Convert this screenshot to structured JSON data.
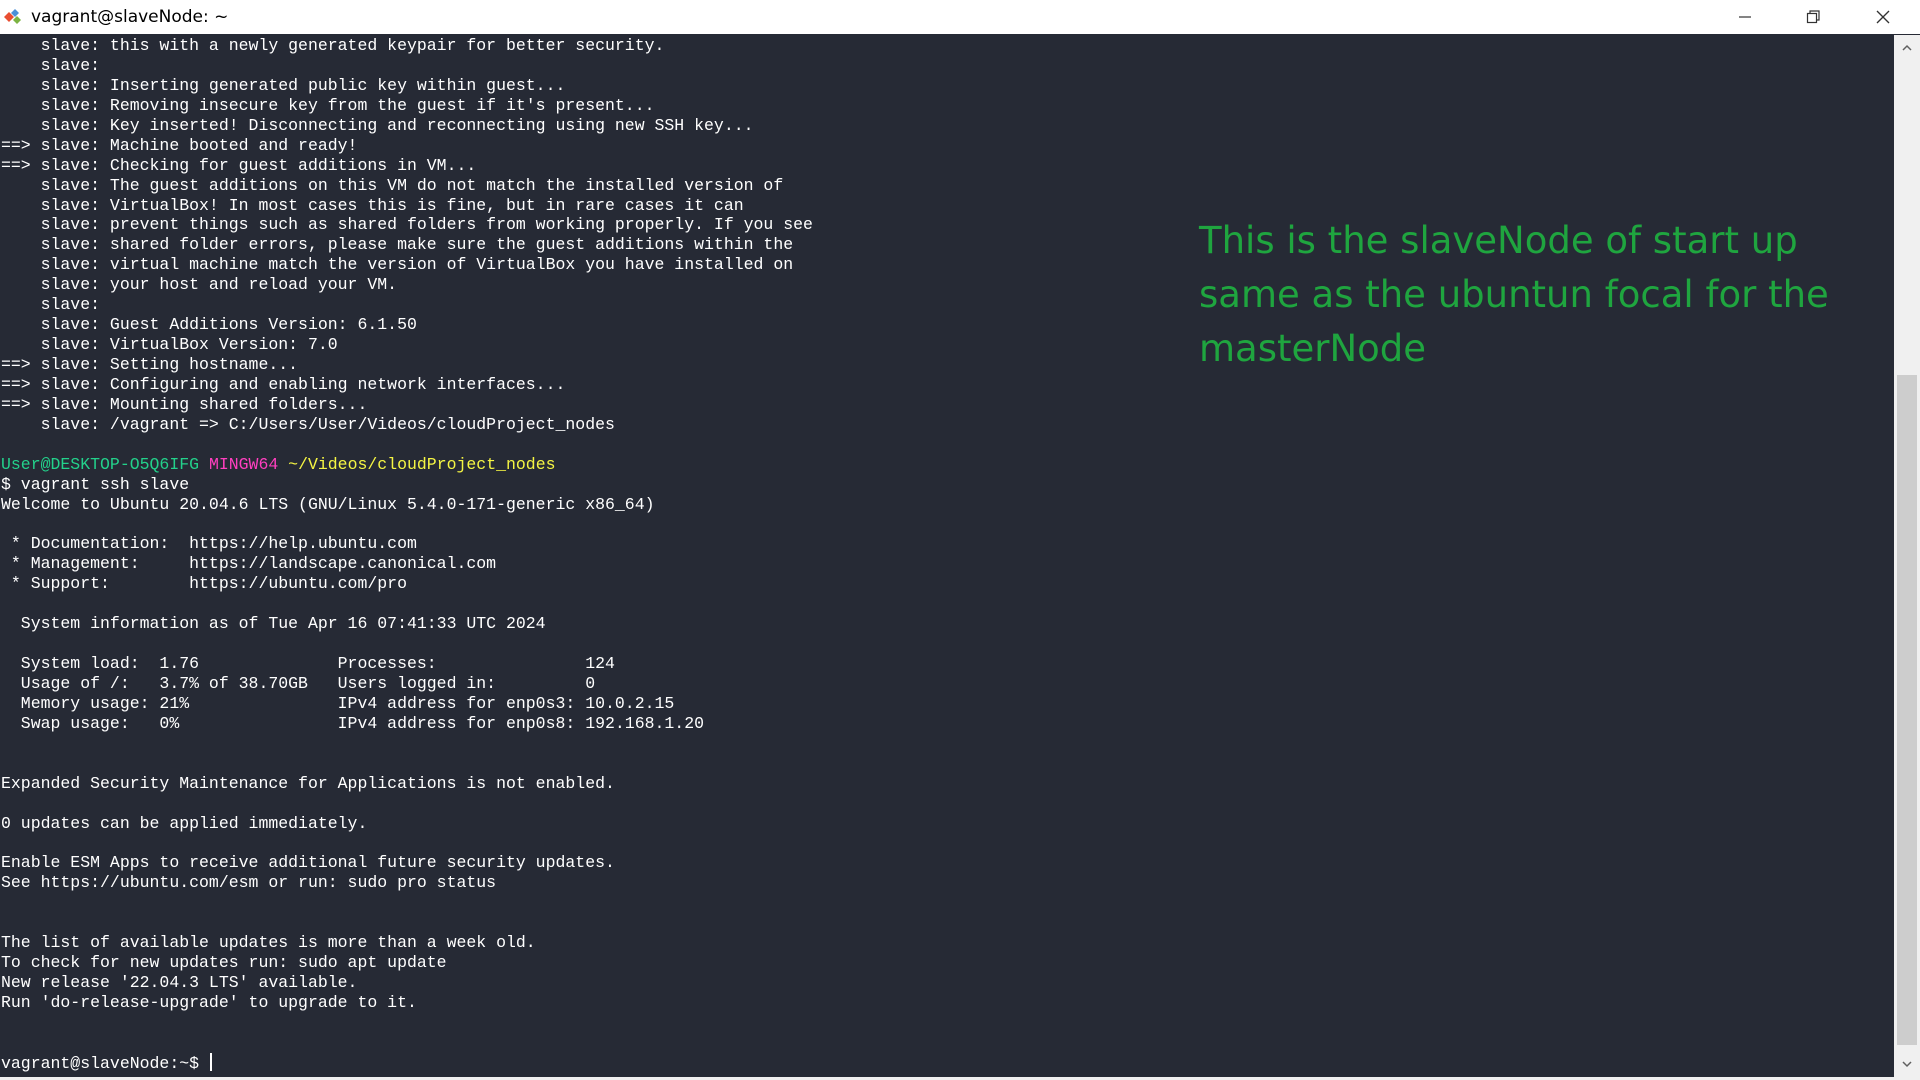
{
  "window": {
    "title": "vagrant@slaveNode: ~",
    "app_icon": "mintty-git-icon"
  },
  "controls": {
    "minimize_icon": "minimize-icon",
    "maximize_icon": "restore-icon",
    "close_icon": "close-icon"
  },
  "terminal": {
    "lines": [
      {
        "text": "    slave: this with a newly generated keypair for better security."
      },
      {
        "text": "    slave:"
      },
      {
        "text": "    slave: Inserting generated public key within guest..."
      },
      {
        "text": "    slave: Removing insecure key from the guest if it's present..."
      },
      {
        "text": "    slave: Key inserted! Disconnecting and reconnecting using new SSH key..."
      },
      {
        "text": "==> slave: Machine booted and ready!"
      },
      {
        "text": "==> slave: Checking for guest additions in VM..."
      },
      {
        "text": "    slave: The guest additions on this VM do not match the installed version of"
      },
      {
        "text": "    slave: VirtualBox! In most cases this is fine, but in rare cases it can"
      },
      {
        "text": "    slave: prevent things such as shared folders from working properly. If you see"
      },
      {
        "text": "    slave: shared folder errors, please make sure the guest additions within the"
      },
      {
        "text": "    slave: virtual machine match the version of VirtualBox you have installed on"
      },
      {
        "text": "    slave: your host and reload your VM."
      },
      {
        "text": "    slave:"
      },
      {
        "text": "    slave: Guest Additions Version: 6.1.50"
      },
      {
        "text": "    slave: VirtualBox Version: 7.0"
      },
      {
        "text": "==> slave: Setting hostname..."
      },
      {
        "text": "==> slave: Configuring and enabling network interfaces..."
      },
      {
        "text": "==> slave: Mounting shared folders..."
      },
      {
        "text": "    slave: /vagrant => C:/Users/User/Videos/cloudProject_nodes"
      },
      {
        "text": ""
      },
      {
        "segments": [
          {
            "text": "User@DESKTOP-O5Q6IFG",
            "color": "green"
          },
          {
            "text": " ",
            "color": ""
          },
          {
            "text": "MINGW64",
            "color": "magenta"
          },
          {
            "text": " ",
            "color": ""
          },
          {
            "text": "~/Videos/cloudProject_nodes",
            "color": "yellow"
          }
        ]
      },
      {
        "text": "$ vagrant ssh slave"
      },
      {
        "text": "Welcome to Ubuntu 20.04.6 LTS (GNU/Linux 5.4.0-171-generic x86_64)"
      },
      {
        "text": ""
      },
      {
        "text": " * Documentation:  https://help.ubuntu.com"
      },
      {
        "text": " * Management:     https://landscape.canonical.com"
      },
      {
        "text": " * Support:        https://ubuntu.com/pro"
      },
      {
        "text": ""
      },
      {
        "text": "  System information as of Tue Apr 16 07:41:33 UTC 2024"
      },
      {
        "text": ""
      },
      {
        "text": "  System load:  1.76              Processes:               124"
      },
      {
        "text": "  Usage of /:   3.7% of 38.70GB   Users logged in:         0"
      },
      {
        "text": "  Memory usage: 21%               IPv4 address for enp0s3: 10.0.2.15"
      },
      {
        "text": "  Swap usage:   0%                IPv4 address for enp0s8: 192.168.1.20"
      },
      {
        "text": ""
      },
      {
        "text": ""
      },
      {
        "text": "Expanded Security Maintenance for Applications is not enabled."
      },
      {
        "text": ""
      },
      {
        "text": "0 updates can be applied immediately."
      },
      {
        "text": ""
      },
      {
        "text": "Enable ESM Apps to receive additional future security updates."
      },
      {
        "text": "See https://ubuntu.com/esm or run: sudo pro status"
      },
      {
        "text": ""
      },
      {
        "text": ""
      },
      {
        "text": "The list of available updates is more than a week old."
      },
      {
        "text": "To check for new updates run: sudo apt update"
      },
      {
        "text": "New release '22.04.3 LTS' available."
      },
      {
        "text": "Run 'do-release-upgrade' to upgrade to it."
      },
      {
        "text": ""
      },
      {
        "text": ""
      },
      {
        "text": "vagrant@slaveNode:~$ ",
        "cursor": true
      }
    ]
  },
  "annotation": {
    "text": "This is the slaveNode of start up same as the ubuntun focal for the masterNode",
    "color": "#1fa53f"
  },
  "scrollbar": {
    "up_icon": "scroll-up-arrow-icon",
    "down_icon": "scroll-down-arrow-icon",
    "position": 0.33
  },
  "colors": {
    "background": "#262a35",
    "foreground": "#ffffff",
    "green": "#23d18b",
    "magenta": "#ff3fbf",
    "yellow": "#f5f543"
  }
}
